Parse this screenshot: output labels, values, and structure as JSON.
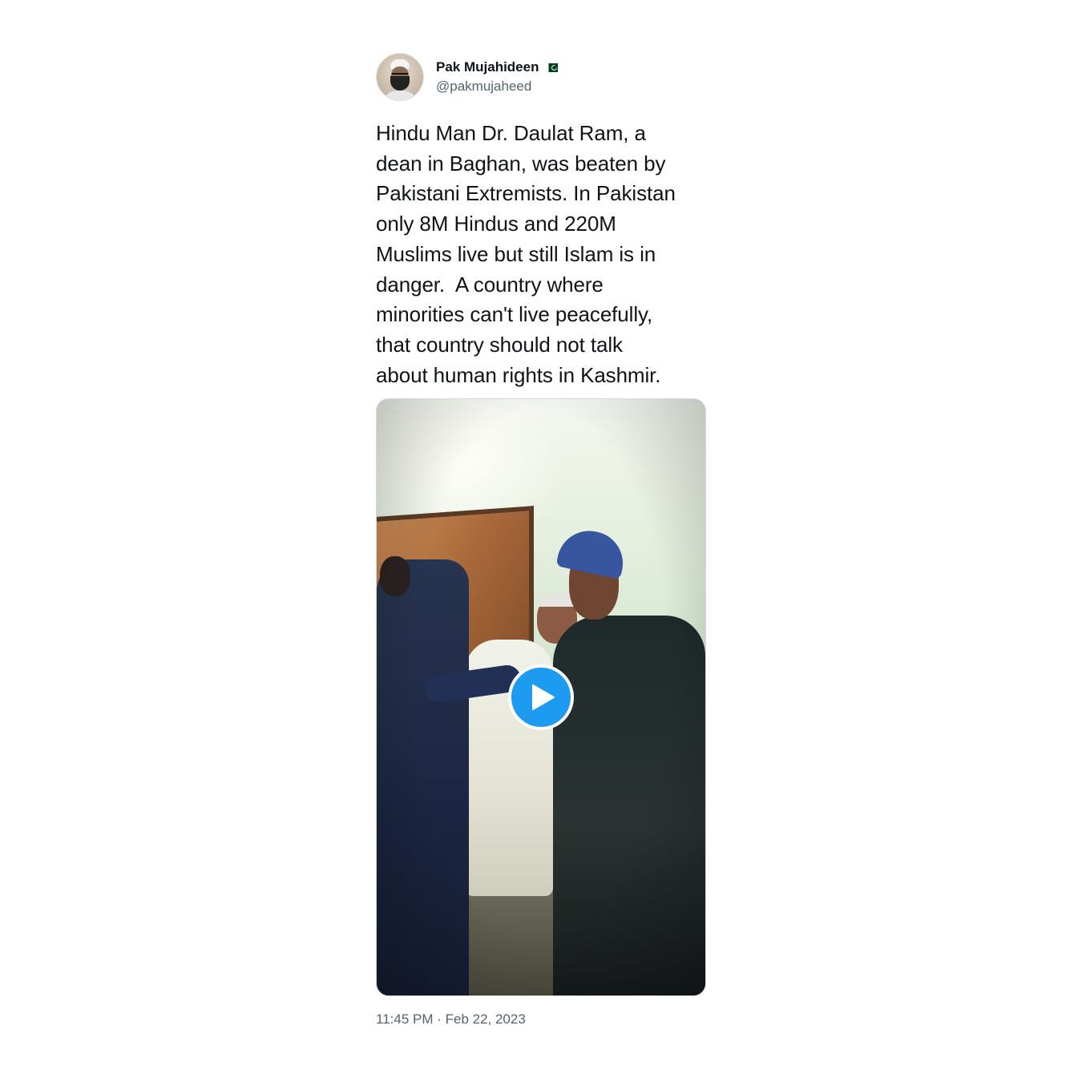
{
  "tweet": {
    "display_name": "Pak Mujahideen",
    "handle": "@pakmujaheed",
    "flag_icon": "pakistan-flag-icon",
    "text": "Hindu Man Dr. Daulat Ram, a\ndean in Baghan, was beaten by\nPakistani Extremists. In Pakistan\nonly 8M Hindus and 220M\nMuslims live but still Islam is in\ndanger.  A country where\nminorities can't live peacefully,\nthat country should not talk\nabout human rights in Kashmir.",
    "media": {
      "type": "video",
      "play_icon": "play-icon"
    },
    "timestamp": "11:45 PM · Feb 22, 2023"
  },
  "colors": {
    "accent": "#1d9bf0",
    "secondary_text": "#536471",
    "primary_text": "#0f1419",
    "border": "#cfd9de"
  }
}
